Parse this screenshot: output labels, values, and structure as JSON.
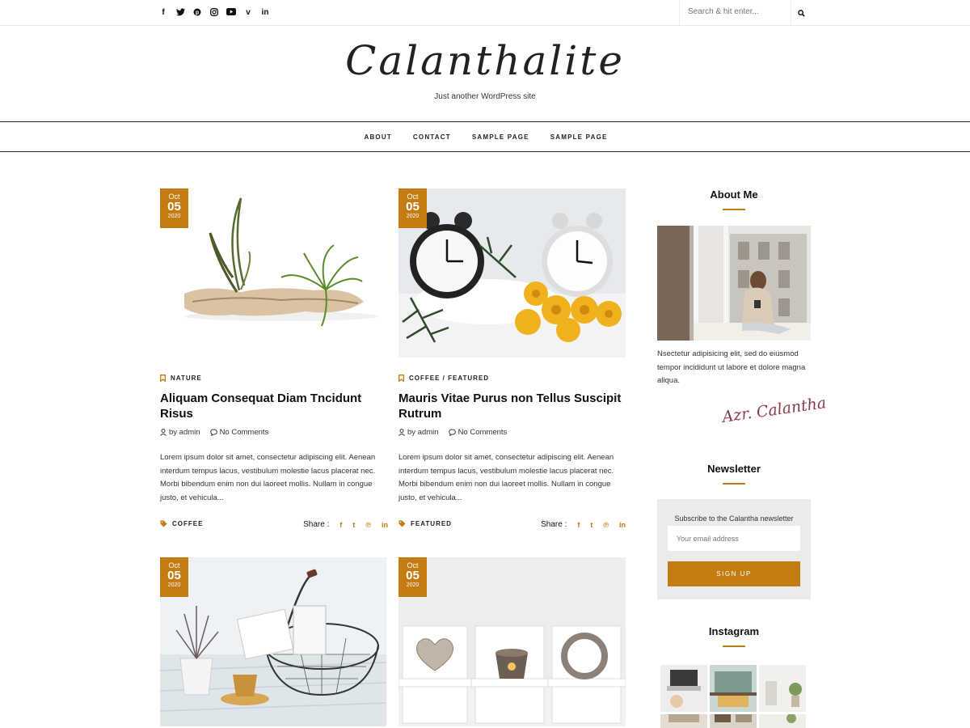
{
  "topbar": {
    "socials": [
      {
        "icon": "facebook-icon",
        "glyph": "f"
      },
      {
        "icon": "twitter-icon",
        "glyph": "🐦"
      },
      {
        "icon": "pinterest-icon",
        "glyph": "P"
      },
      {
        "icon": "instagram-icon",
        "glyph": "◎"
      },
      {
        "icon": "youtube-icon",
        "glyph": "▶"
      },
      {
        "icon": "vimeo-icon",
        "glyph": "v"
      },
      {
        "icon": "linkedin-icon",
        "glyph": "in"
      }
    ],
    "search_placeholder": "Search & hit enter..."
  },
  "header": {
    "logo": "Calanthalite",
    "tagline": "Just another WordPress site"
  },
  "nav": [
    "ABOUT",
    "CONTACT",
    "SAMPLE PAGE",
    "SAMPLE PAGE"
  ],
  "posts": [
    {
      "date": {
        "month": "Oct",
        "day": "05",
        "year": "2020"
      },
      "categories": "NATURE",
      "title": "Aliquam Consequat Diam Tncidunt Risus",
      "author": "by admin",
      "comments": "No Comments",
      "excerpt": "Lorem ipsum dolor sit amet, consectetur adipiscing elit. Aenean interdum tempus lacus, vestibulum molestie lacus placerat nec. Morbi bibendum enim non dui laoreet mollis. Nullam in congue justo, et vehicula...",
      "tag": "COFFEE",
      "share_label": "Share :"
    },
    {
      "date": {
        "month": "Oct",
        "day": "05",
        "year": "2020"
      },
      "categories": "COFFEE / FEATURED",
      "title": "Mauris Vitae Purus non Tellus Suscipit Rutrum",
      "author": "by admin",
      "comments": "No Comments",
      "excerpt": "Lorem ipsum dolor sit amet, consectetur adipiscing elit. Aenean interdum tempus lacus, vestibulum molestie lacus placerat nec. Morbi bibendum enim non dui laoreet mollis. Nullam in congue justo, et vehicula...",
      "tag": "FEATURED",
      "share_label": "Share :"
    },
    {
      "date": {
        "month": "Oct",
        "day": "05",
        "year": "2020"
      }
    },
    {
      "date": {
        "month": "Oct",
        "day": "05",
        "year": "2020"
      }
    }
  ],
  "sidebar": {
    "about_title": "About Me",
    "about_text": "Nsectetur adipisicing elit, sed do eiusmod tempor incididunt ut labore et dolore magna aliqua.",
    "signature": "Azr. Calantha",
    "newsletter_title": "Newsletter",
    "newsletter_text": "Subscribe to the Calantha newsletter",
    "newsletter_placeholder": "Your email address",
    "newsletter_button": "SIGN UP",
    "instagram_title": "Instagram"
  },
  "colors": {
    "accent": "#c47b11"
  }
}
